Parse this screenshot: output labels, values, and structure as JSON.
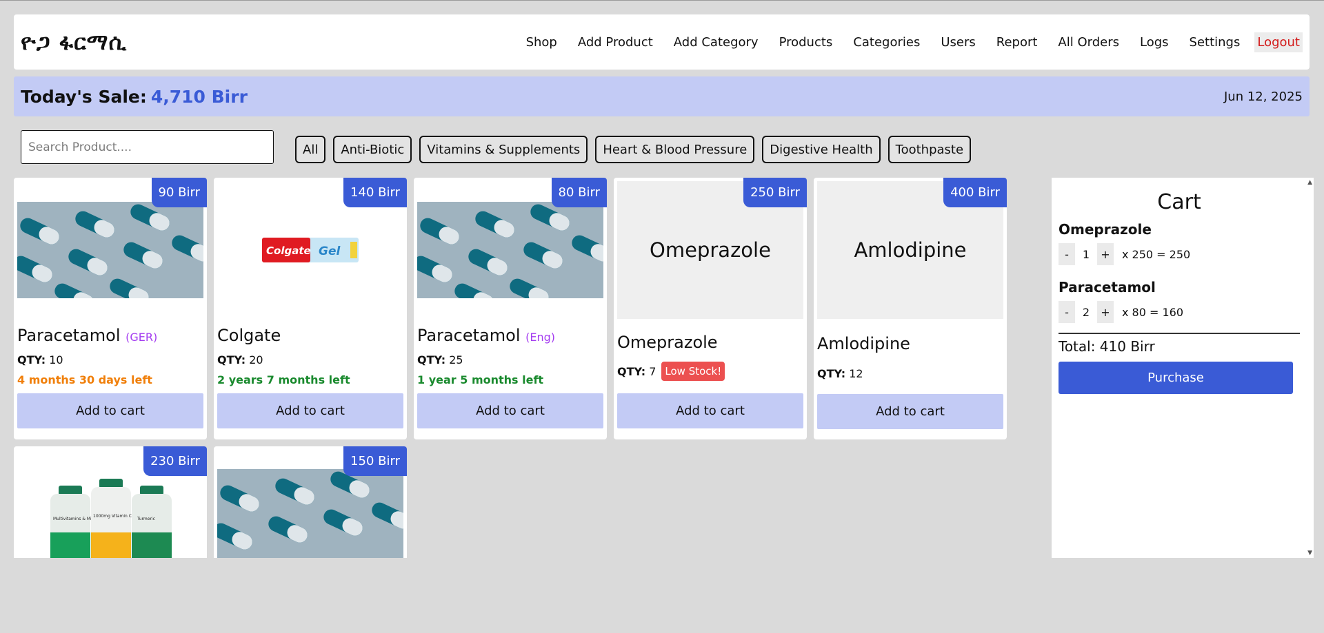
{
  "header": {
    "logo": "ዮጋ ፋርማሲ",
    "nav": [
      "Shop",
      "Add Product",
      "Add Category",
      "Products",
      "Categories",
      "Users",
      "Report",
      "All Orders",
      "Logs",
      "Settings"
    ],
    "logout": "Logout"
  },
  "sale": {
    "label": "Today's Sale:",
    "value": "4,710 Birr",
    "date": "Jun 12, 2025"
  },
  "search": {
    "placeholder": "Search Product...."
  },
  "filters": [
    "All",
    "Anti-Biotic",
    "Vitamins & Supplements",
    "Heart & Blood Pressure",
    "Digestive Health",
    "Toothpaste"
  ],
  "products": [
    {
      "price": "90 Birr",
      "name": "Paracetamol",
      "tag": "(GER)",
      "qty_label": "QTY:",
      "qty": "10",
      "expiry": "4 months 30 days left",
      "expiry_color": "#f07f0a",
      "image": "pills-icon",
      "add": "Add to cart"
    },
    {
      "price": "140 Birr",
      "name": "Colgate",
      "qty_label": "QTY:",
      "qty": "20",
      "expiry": "2 years 7 months left",
      "expiry_color": "#1a8a2e",
      "image": "toothpaste-icon",
      "add": "Add to cart"
    },
    {
      "price": "80 Birr",
      "name": "Paracetamol",
      "tag": "(Eng)",
      "qty_label": "QTY:",
      "qty": "25",
      "expiry": "1 year 5 months left",
      "expiry_color": "#1a8a2e",
      "image": "pills-icon",
      "add": "Add to cart"
    },
    {
      "price": "250 Birr",
      "name": "Omeprazole",
      "placeholder": "Omeprazole",
      "qty_label": "QTY:",
      "qty": "7",
      "badge": "Low Stock!",
      "add": "Add to cart"
    },
    {
      "price": "400 Birr",
      "name": "Amlodipine",
      "placeholder": "Amlodipine",
      "qty_label": "QTY:",
      "qty": "12",
      "add": "Add to cart"
    },
    {
      "price": "230 Birr",
      "image": "supplement-bottles-icon",
      "bottle_labels": [
        "Multivitamins & Minerals",
        "1000mg Vitamin C",
        "Turmeric"
      ]
    },
    {
      "price": "150 Birr",
      "image": "pills-icon"
    }
  ],
  "colgate_brand": "Colgate",
  "colgate_gel": "Gel",
  "cart": {
    "title": "Cart",
    "items": [
      {
        "name": "Omeprazole",
        "minus": "-",
        "qty": "1",
        "plus": "+",
        "calc": "x 250 = 250"
      },
      {
        "name": "Paracetamol",
        "minus": "-",
        "qty": "2",
        "plus": "+",
        "calc": "x 80 = 160"
      }
    ],
    "total": "Total: 410 Birr",
    "purchase": "Purchase"
  },
  "colors": {
    "accent": "#3a5bd6",
    "light_accent": "#c3cbf5",
    "logout": "#d31a1a",
    "low_stock": "#ec5050",
    "tag": "#a43cf0"
  }
}
